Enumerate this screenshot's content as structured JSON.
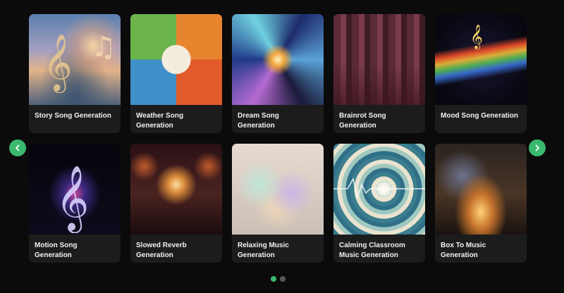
{
  "cards": [
    {
      "title": "Story Song Generation"
    },
    {
      "title": "Weather Song Generation"
    },
    {
      "title": "Dream Song Generation"
    },
    {
      "title": "Brainrot Song Generation"
    },
    {
      "title": "Mood Song Generation"
    },
    {
      "title": "Motion Song Generation"
    },
    {
      "title": "Slowed Reverb Generation"
    },
    {
      "title": "Relaxing Music Generation"
    },
    {
      "title": "Calming Classroom Music Generation"
    },
    {
      "title": "Box To Music Generation"
    }
  ],
  "navigation": {
    "prev_icon": "chevron-left-icon",
    "next_icon": "chevron-right-icon"
  },
  "pagination": {
    "current_page": 1,
    "total_pages": 2
  },
  "colors": {
    "accent": "#3ab86e",
    "background": "#0b0b0b",
    "card_background": "#1c1c1c",
    "dot_inactive": "#5a5a5a"
  }
}
